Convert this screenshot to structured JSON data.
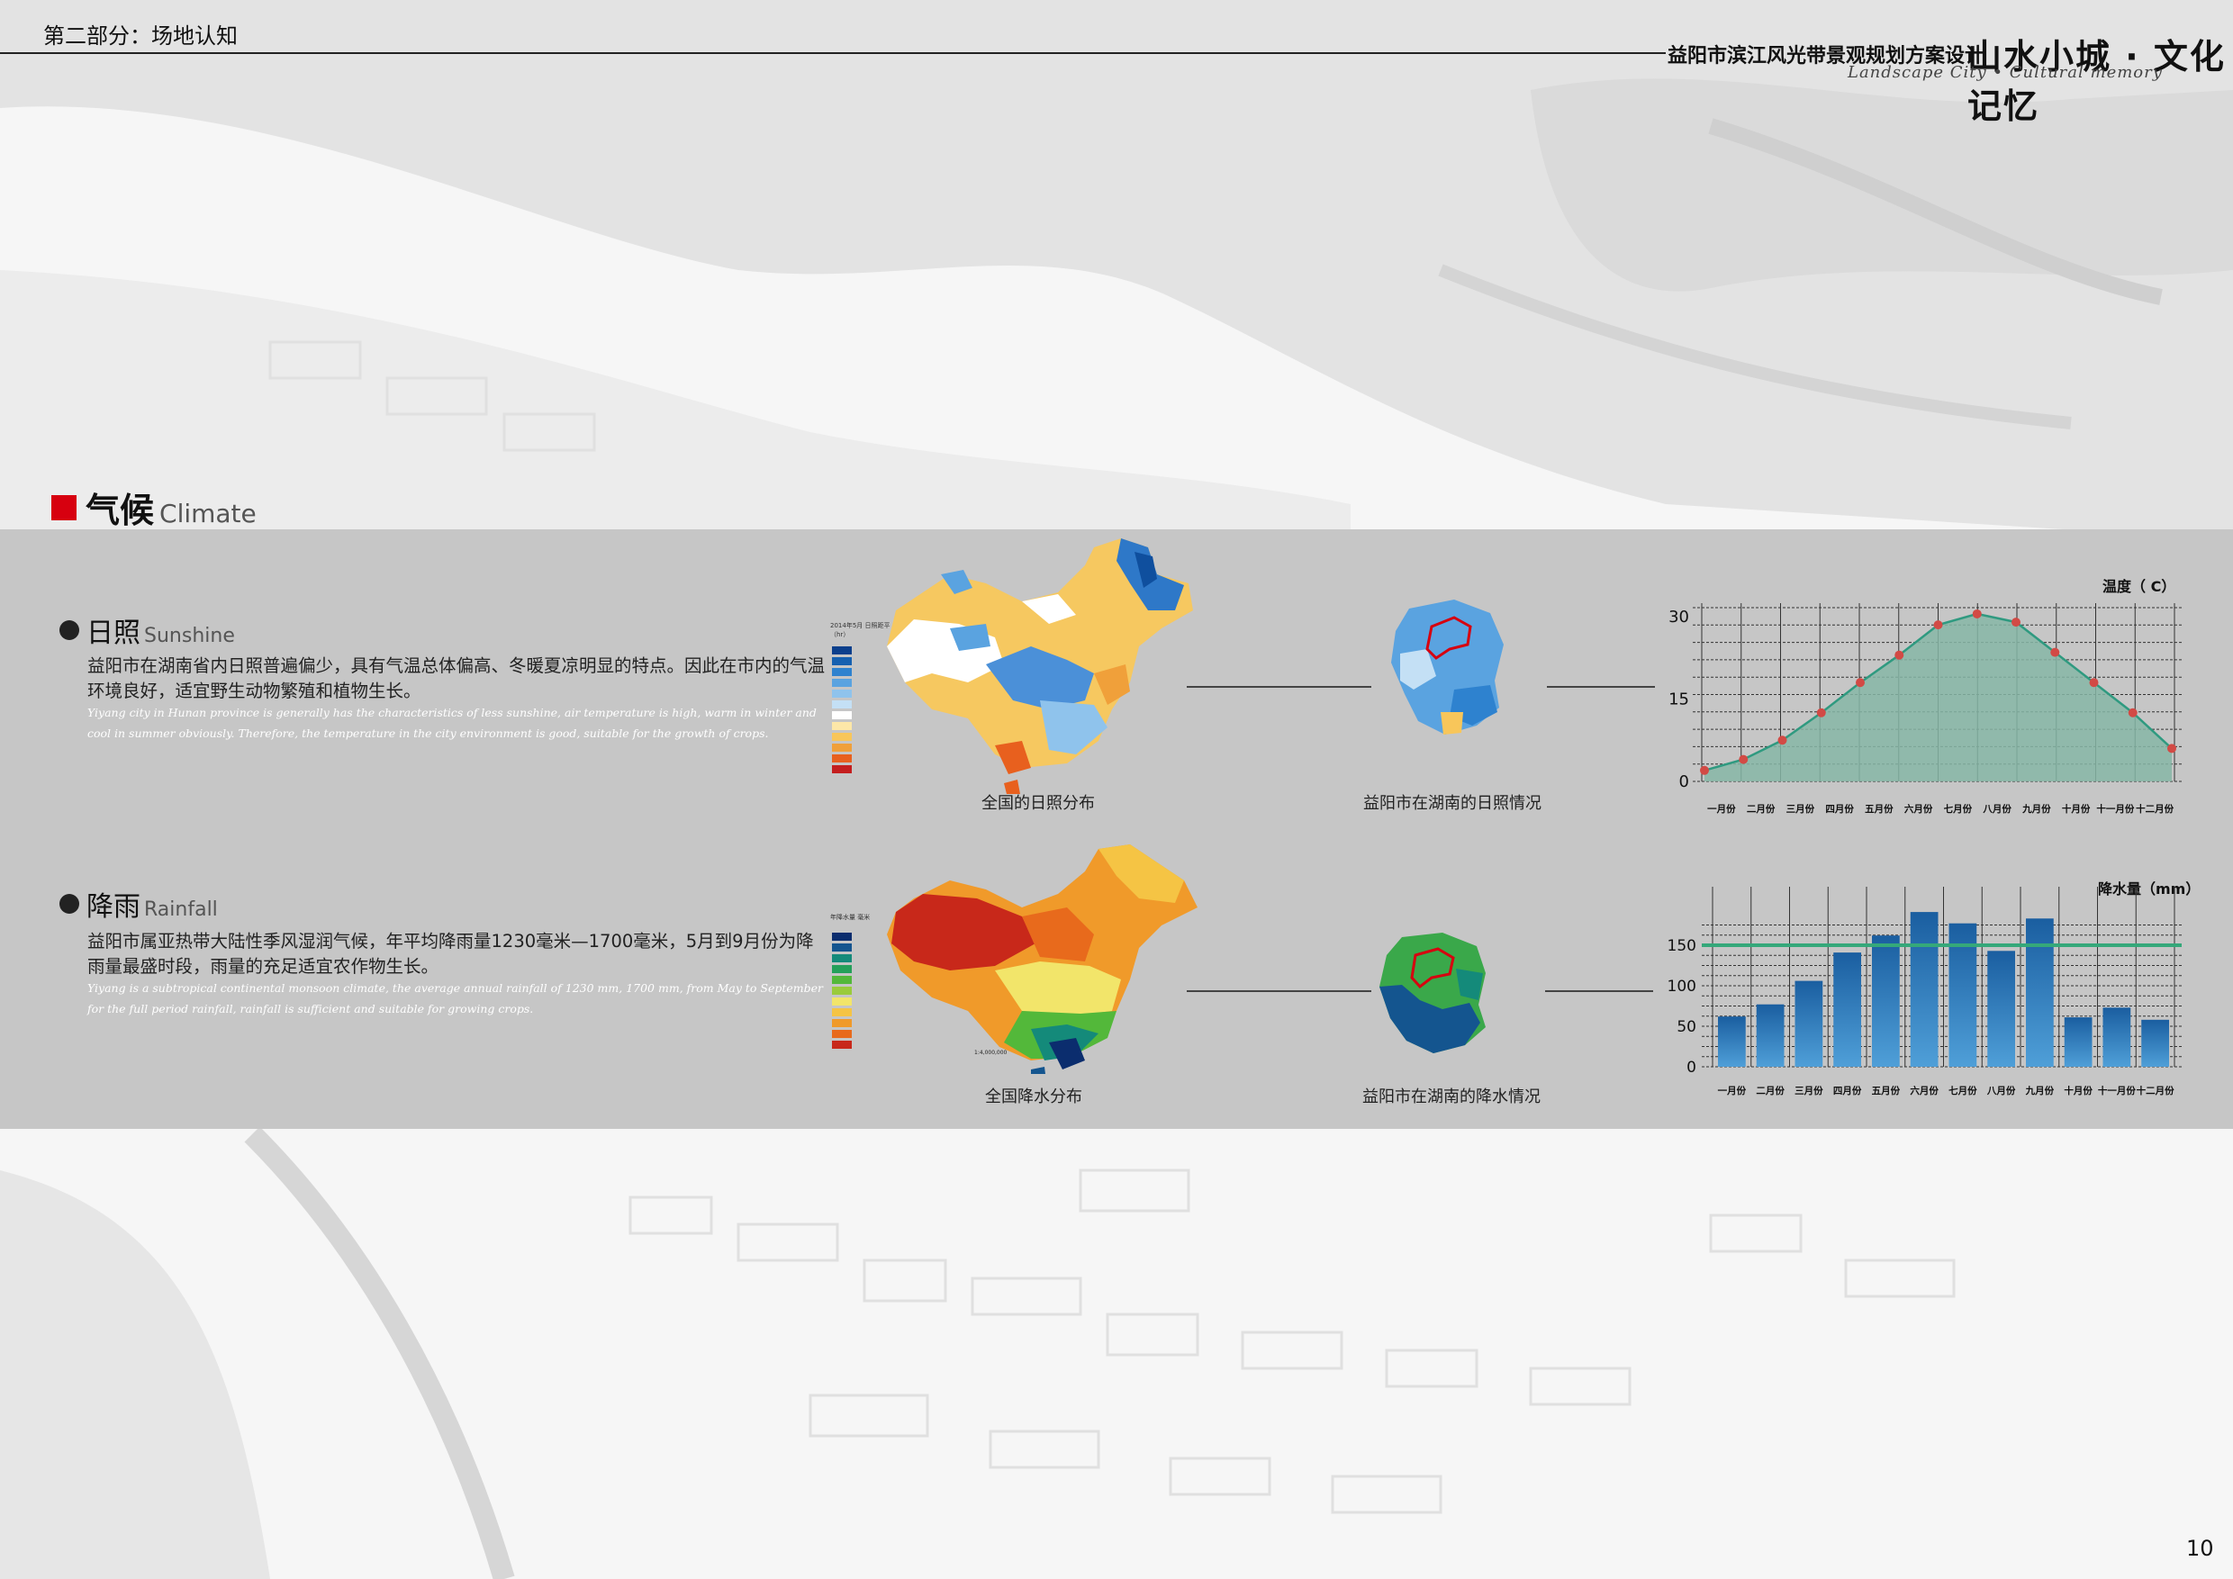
{
  "header": {
    "section_label": "第二部分：场地认知",
    "project_title": "益阳市滨江风光带景观规划方案设计",
    "slogan": "山水小城 · 文化记忆",
    "slogan_en": "Landscape City • Cultural memory"
  },
  "climate": {
    "title_cn": "气候",
    "title_en": "Climate"
  },
  "sunshine": {
    "title_cn": "日照",
    "title_en": "Sunshine",
    "body_cn": "益阳市在湖南省内日照普遍偏少，具有气温总体偏高、冬暖夏凉明显的特点。因此在市内的气温环境良好，适宜野生动物繁殖和植物生长。",
    "body_en": "Yiyang city in Hunan province is generally has the characteristics of less sunshine, air temperature is high, warm in winter and cool in summer obviously. Therefore, the temperature in the city environment is good, suitable for the growth of crops.",
    "map_caption": "全国的日照分布",
    "local_caption": "益阳市在湖南的日照情况",
    "legend_title": "2014年5月 日照距平（hr）"
  },
  "rainfall": {
    "title_cn": "降雨",
    "title_en": "Rainfall",
    "body_cn": "益阳市属亚热带大陆性季风湿润气候，年平均降雨量1230毫米—1700毫米，5月到9月份为降雨量最盛时段，雨量的充足适宜农作物生长。",
    "body_en": "Yiyang is a subtropical continental monsoon climate, the average annual rainfall of 1230 mm, 1700 mm, from May to September for the full period rainfall, rainfall is sufficient and suitable for growing crops.",
    "map_caption": "全国降水分布",
    "local_caption": "益阳市在湖南的降水情况",
    "legend_title": "年降水量 毫米",
    "scale": "1:4,000,000"
  },
  "colors": {
    "accent_red": "#d7000f",
    "band_gray": "#c6c6c6",
    "temp_fill": "#86b6a6",
    "temp_line": "#2f9a80",
    "temp_marker": "#d24a45",
    "rain_bar": "#2e7fc0",
    "rain_ref_line": "#35a87a"
  },
  "chart_data": [
    {
      "type": "area",
      "title": "",
      "ylabel": "温度（ C）",
      "categories": [
        "一月份",
        "二月份",
        "三月份",
        "四月份",
        "五月份",
        "六月份",
        "七月份",
        "八月份",
        "九月份",
        "十月份",
        "十一月份",
        "十二月份"
      ],
      "values": [
        2,
        4,
        7.5,
        12.5,
        18,
        23,
        28.5,
        30.5,
        29,
        23.5,
        18,
        12.5,
        6
      ],
      "yticks": [
        0,
        15,
        30
      ],
      "ylim": [
        0,
        30
      ],
      "grid": true
    },
    {
      "type": "bar",
      "title": "",
      "ylabel": "降水量（mm）",
      "categories": [
        "一月份",
        "二月份",
        "三月份",
        "四月份",
        "五月份",
        "六月份",
        "七月份",
        "八月份",
        "九月份",
        "十月份",
        "十一月份",
        "十二月份"
      ],
      "values": [
        62,
        77,
        106,
        141,
        162,
        191,
        177,
        143,
        183,
        61,
        73,
        58
      ],
      "reference_line": 150,
      "yticks": [
        0,
        50,
        100,
        150
      ],
      "ylim": [
        0,
        200
      ],
      "grid": true
    }
  ]
}
